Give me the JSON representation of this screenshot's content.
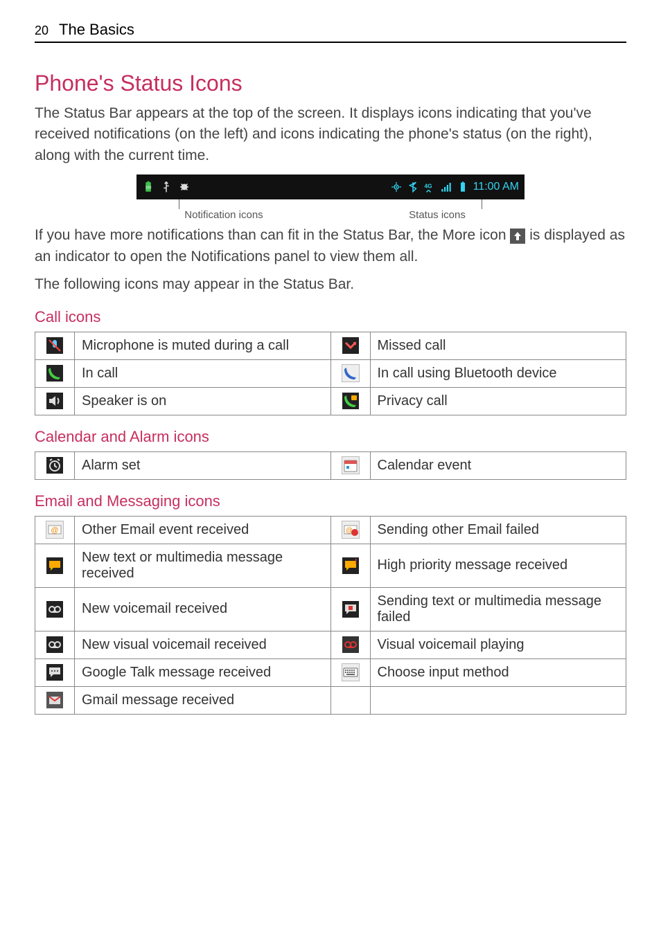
{
  "page": {
    "number": "20",
    "chapter": "The Basics"
  },
  "title": "Phone's Status Icons",
  "intro": "The Status Bar appears at the top of the screen. It displays icons indicating that you've received notifications (on the left) and icons indicating the phone's status (on the right), along with the current time.",
  "statusbar": {
    "time": "11:00 AM",
    "caption_left": "Notification icons",
    "caption_right": "Status icons"
  },
  "more_note_pre": "If you have more notifications than can fit in the Status Bar, the More icon ",
  "more_note_post": " is displayed as an indicator to open the Notifications panel to view them all.",
  "following": "The following icons may appear in the Status Bar.",
  "sections": {
    "call": {
      "heading": "Call icons",
      "rows": [
        {
          "l": "Microphone is muted during a call",
          "r": "Missed call"
        },
        {
          "l": "In call",
          "r": "In call using Bluetooth device"
        },
        {
          "l": "Speaker is on",
          "r": "Privacy call"
        }
      ]
    },
    "calendar": {
      "heading": "Calendar and Alarm icons",
      "rows": [
        {
          "l": "Alarm set",
          "r": "Calendar event"
        }
      ]
    },
    "email": {
      "heading": "Email and Messaging icons",
      "rows": [
        {
          "l": "Other Email event received",
          "r": "Sending other Email failed"
        },
        {
          "l": "New text or multimedia message received",
          "r": "High priority message received"
        },
        {
          "l": "New voicemail received",
          "r": "Sending text or multimedia message failed"
        },
        {
          "l": "New visual voicemail received",
          "r": "Visual voicemail playing"
        },
        {
          "l": "Google Talk message received",
          "r": "Choose input method"
        },
        {
          "l": "Gmail message received",
          "r": ""
        }
      ]
    }
  }
}
